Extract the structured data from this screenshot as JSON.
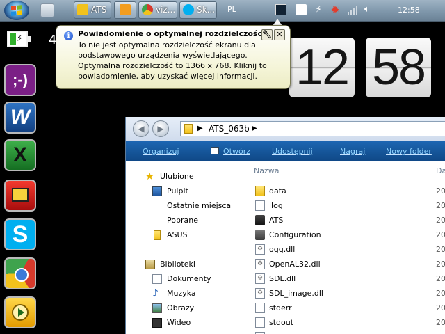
{
  "taskbar": {
    "tasks": [
      {
        "label": "ATS",
        "color": "#f2c21c"
      },
      {
        "label": "",
        "color": "#f29d1f"
      },
      {
        "label": "viz...",
        "color": "#d63a2c"
      },
      {
        "label": "Sk...",
        "color": "#00aff0"
      }
    ],
    "language": "PL",
    "clock": "12:58"
  },
  "desktop": {
    "battery_text": "4",
    "clock_hours": "12",
    "clock_minutes": "58",
    "dock_items": [
      {
        "label": ";-)",
        "icon": "emoticon-icon",
        "bg": "#7b1f86"
      },
      {
        "label": "W",
        "icon": "word-icon",
        "bg": "#1d5aa6"
      },
      {
        "label": "X",
        "icon": "excel-icon",
        "bg": "#1e8c2f"
      },
      {
        "label": "",
        "icon": "presentation-icon",
        "bg": "#d11818"
      },
      {
        "label": "S",
        "icon": "skype-icon",
        "bg": "#00aff0"
      },
      {
        "label": "",
        "icon": "chrome-icon",
        "bg": "#d63a2c"
      },
      {
        "label": "",
        "icon": "media-player-icon",
        "bg": "#f2b400"
      }
    ]
  },
  "notification": {
    "title": "Powiadomienie o optymalnej rozdzielczości",
    "body": "To nie jest optymalna rozdzielczość ekranu dla podstawowego urządzenia wyświetlającego. Optymalna rozdzielczość to 1366 x 768. Kliknij to powiadomienie, aby uzyskać więcej informacji."
  },
  "explorer": {
    "path": "ATS_063b",
    "toolbar": [
      "Organizuj",
      "Otwórz",
      "Udostępnij",
      "Nagraj",
      "Nowy folder"
    ],
    "nav_favorites_header": "Ulubione",
    "nav_favorites": [
      "Pulpit",
      "Ostatnie miejsca",
      "Pobrane"
    ],
    "nav_asus": "ASUS",
    "nav_libraries_header": "Biblioteki",
    "nav_libraries": [
      "Dokumenty",
      "Muzyka",
      "Obrazy",
      "Wideo"
    ],
    "col_name": "Nazwa",
    "col_date": "Da",
    "files": [
      {
        "name": "data",
        "type": "folder",
        "date": "20"
      },
      {
        "name": "llog",
        "type": "doc",
        "date": "20"
      },
      {
        "name": "ATS",
        "type": "app",
        "date": "20"
      },
      {
        "name": "Configuration",
        "type": "config",
        "date": "20"
      },
      {
        "name": "ogg.dll",
        "type": "dll",
        "date": "20"
      },
      {
        "name": "OpenAL32.dll",
        "type": "dll",
        "date": "20"
      },
      {
        "name": "SDL.dll",
        "type": "dll",
        "date": "20"
      },
      {
        "name": "SDL_image.dll",
        "type": "dll",
        "date": "20"
      },
      {
        "name": "stderr",
        "type": "doc",
        "date": "20"
      },
      {
        "name": "stdout",
        "type": "doc",
        "date": "20"
      }
    ]
  }
}
